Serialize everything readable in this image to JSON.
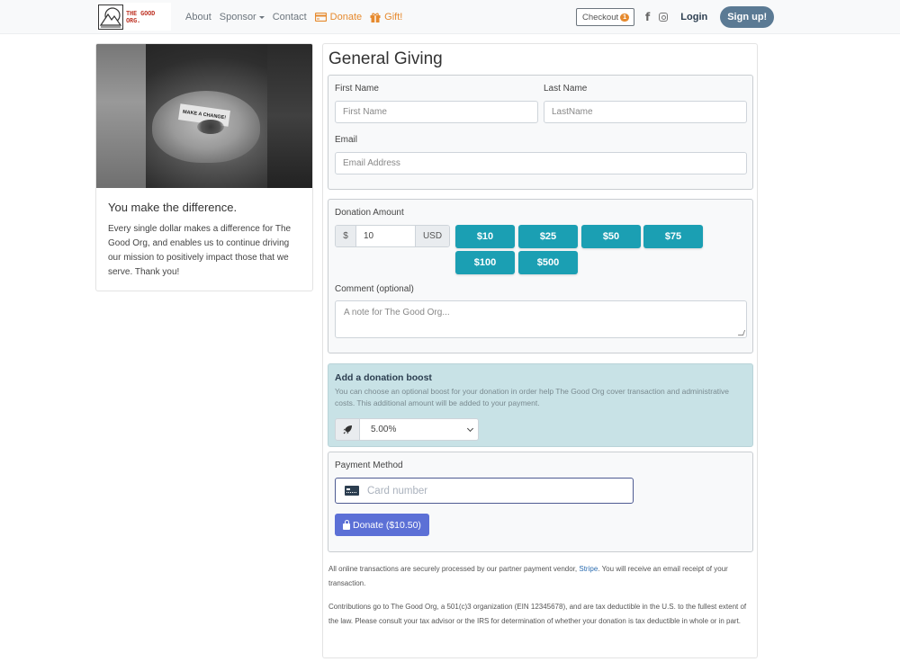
{
  "navbar": {
    "logo_text": "THE GOOD ORG.",
    "links": [
      {
        "label": "About"
      },
      {
        "label": "Sponsor"
      },
      {
        "label": "Contact"
      },
      {
        "label": "Donate"
      },
      {
        "label": "Gift!"
      }
    ],
    "checkout_label": "Checkout",
    "checkout_count": "1",
    "login_label": "Login",
    "signup_label": "Sign up!"
  },
  "left_card": {
    "image_note_text": "MAKE A CHANGE!",
    "title": "You make the difference.",
    "body": "Every single dollar makes a difference for The Good Org, and enables us to continue driving our mission to positively impact those that we serve. Thank you!"
  },
  "form": {
    "title": "General Giving",
    "first_name_label": "First Name",
    "first_name_placeholder": "First Name",
    "last_name_label": "Last Name",
    "last_name_placeholder": "LastName",
    "email_label": "Email",
    "email_placeholder": "Email Address",
    "donation_label": "Donation Amount",
    "currency_symbol": "$",
    "amount_value": "10",
    "currency_code": "USD",
    "preset_amounts": [
      "$10",
      "$25",
      "$50",
      "$75",
      "$100",
      "$500"
    ],
    "comment_label": "Comment (optional)",
    "comment_placeholder": "A note for The Good Org...",
    "boost_title": "Add a donation boost",
    "boost_description": "You can choose an optional boost for your donation in order help The Good Org cover transaction and administrative costs. This additional amount will be added to your payment.",
    "boost_selected": "5.00%",
    "payment_label": "Payment Method",
    "card_placeholder": "Card number",
    "donate_button": "Donate ($10.50)"
  },
  "footer": {
    "line1_before": "All online transactions are securely processed by our partner payment vendor, ",
    "stripe_link": "Stripe",
    "line1_after": ". You will receive an email receipt of your transaction.",
    "line2": "Contributions go to The Good Org, a 501(c)3 organization (EIN 12345678), and are tax deductible in the U.S. to the fullest extent of the law. Please consult your tax advisor or the IRS for determination of whether your donation is tax deductible in whole or in part."
  },
  "colors": {
    "accent_orange": "#e68a2e",
    "preset_teal": "#1b9fb3",
    "donate_blue": "#5c70d6",
    "signup_slate": "#5b7a94",
    "boost_bg": "#c8e2e6"
  }
}
